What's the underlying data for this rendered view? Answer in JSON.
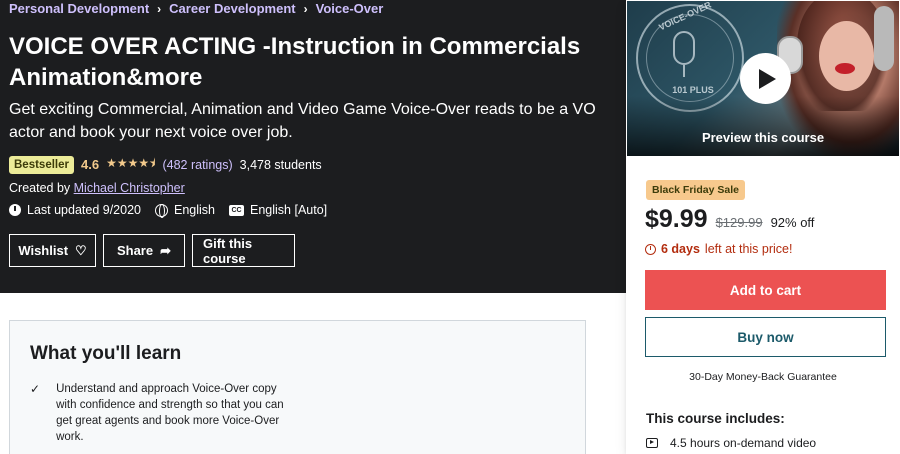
{
  "breadcrumb": [
    {
      "label": "Personal Development"
    },
    {
      "label": "Career Development"
    },
    {
      "label": "Voice-Over"
    }
  ],
  "course": {
    "title": "VOICE OVER ACTING -Instruction in Commercials Animation&more",
    "subtitle": "Get exciting Commercial, Animation and Video Game Voice-Over reads to be a VO actor and book your next voice over job.",
    "badge": "Bestseller",
    "rating": "4.6",
    "stars_value": 4.5,
    "stars_max": 5,
    "ratings_count": "(482 ratings)",
    "students": "3,478 students",
    "created_by_label": "Created by",
    "instructor": "Michael Christopher",
    "last_updated": "Last updated 9/2020",
    "language": "English",
    "captions": "English [Auto]",
    "cc_icon_text": "CC"
  },
  "actions": {
    "wishlist": "Wishlist",
    "share": "Share",
    "gift": "Gift this course"
  },
  "sidebar": {
    "preview_label": "Preview this course",
    "thumbnail_text_top": "VOICE-OVER",
    "thumbnail_text_bottom": "101 PLUS",
    "sale_badge": "Black Friday Sale",
    "price": "$9.99",
    "original_price": "$129.99",
    "discount": "92% off",
    "timer_bold": "6 days",
    "timer_rest": "left at this price!",
    "add_to_cart": "Add to cart",
    "buy_now": "Buy now",
    "guarantee": "30-Day Money-Back Guarantee",
    "includes_title": "This course includes:",
    "includes": [
      {
        "icon": "video-icon",
        "label": "4.5 hours on-demand video"
      }
    ]
  },
  "learn": {
    "title": "What you'll learn",
    "items": [
      "Understand and approach Voice-Over copy with confidence and strength so that you can get great agents and book more Voice-Over work."
    ]
  },
  "colors": {
    "hero_bg": "#1c1d1f",
    "link_purple": "#cec0fc",
    "rating_gold": "#f3ca8c",
    "bestseller_bg": "#eceb98",
    "cart_red": "#ec5252",
    "timer_red": "#b32d0f",
    "sale_badge_bg": "#f7c98d"
  }
}
